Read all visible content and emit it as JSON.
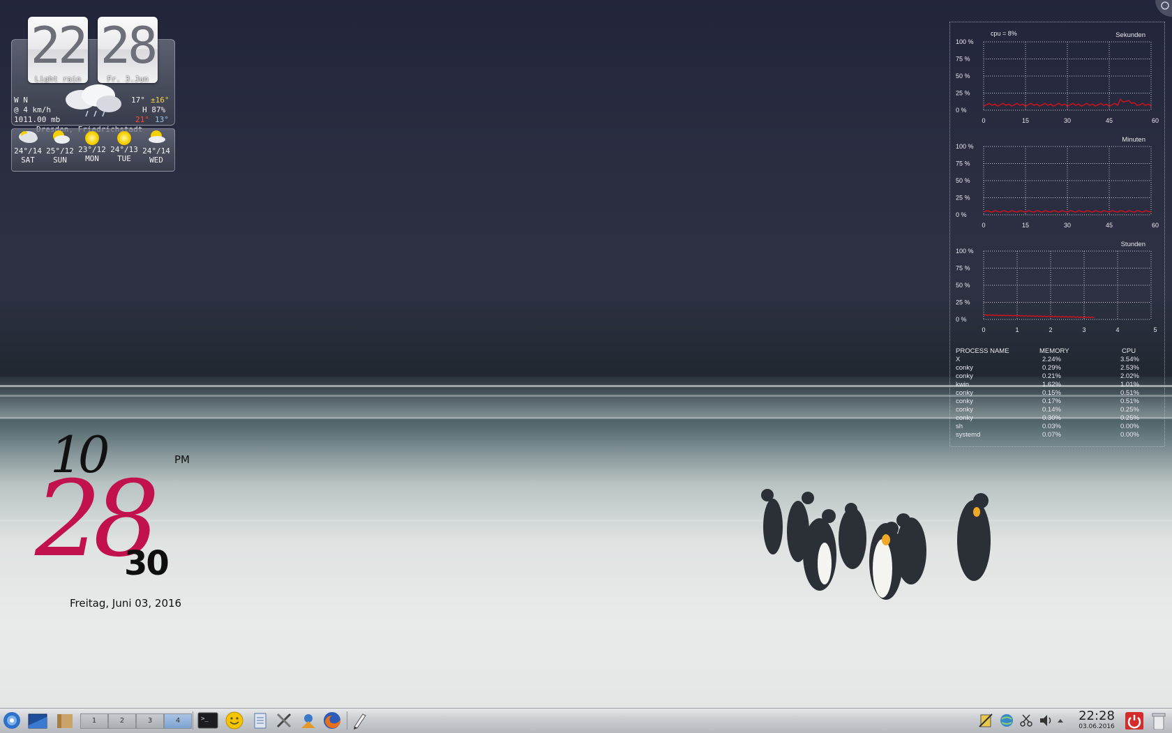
{
  "weather_widget": {
    "hour": "22",
    "minute": "28",
    "condition": "Light rain",
    "date": "Fr. 3.Jun",
    "wind_dir": "W N",
    "wind_speed": "@ 4 km/h",
    "pressure": "1011.00 mb",
    "temp": "17°",
    "feels_like": "±16°",
    "humidity": "H 87%",
    "high": "21°",
    "low": "13°",
    "location": "Dresden, Friedrichstadt",
    "forecast": [
      {
        "temp": "24°/14",
        "day": "SAT",
        "icon": "rain-cloud-icon"
      },
      {
        "temp": "25°/12",
        "day": "SUN",
        "icon": "partly-sunny-icon"
      },
      {
        "temp": "23°/12",
        "day": "MON",
        "icon": "sun-icon"
      },
      {
        "temp": "24°/13",
        "day": "TUE",
        "icon": "sun-icon"
      },
      {
        "temp": "24°/14",
        "day": "WED",
        "icon": "partly-sunny-icon"
      }
    ]
  },
  "monitor": {
    "cpu_label": "cpu = 8%",
    "y_ticks": [
      "100 %",
      "75 %",
      "50 %",
      "25 %",
      "0 %"
    ],
    "graphs": [
      {
        "title": "Sekunden",
        "x_ticks": [
          "0",
          "15",
          "30",
          "45",
          "60"
        ]
      },
      {
        "title": "Minuten",
        "x_ticks": [
          "0",
          "15",
          "30",
          "45",
          "60"
        ]
      },
      {
        "title": "Stunden",
        "x_ticks": [
          "0",
          "1",
          "2",
          "3",
          "4",
          "5"
        ]
      }
    ],
    "process_headers": {
      "name": "PROCESS NAME",
      "memory": "MEMORY",
      "cpu": "CPU"
    },
    "processes": [
      {
        "name": "X",
        "memory": "2.24%",
        "cpu": "3.54%"
      },
      {
        "name": "conky",
        "memory": "0.29%",
        "cpu": "2.53%"
      },
      {
        "name": "conky",
        "memory": "0.21%",
        "cpu": "2.02%"
      },
      {
        "name": "kwin",
        "memory": "1.62%",
        "cpu": "1.01%"
      },
      {
        "name": "conky",
        "memory": "0.15%",
        "cpu": "0.51%"
      },
      {
        "name": "conky",
        "memory": "0.17%",
        "cpu": "0.51%"
      },
      {
        "name": "conky",
        "memory": "0.14%",
        "cpu": "0.25%"
      },
      {
        "name": "conky",
        "memory": "0.30%",
        "cpu": "0.25%"
      },
      {
        "name": "sh",
        "memory": "0.03%",
        "cpu": "0.00%"
      },
      {
        "name": "systemd",
        "memory": "0.07%",
        "cpu": "0.00%"
      }
    ]
  },
  "big_clock": {
    "hour": "10",
    "minute": "28",
    "second": "30",
    "ampm": "PM",
    "date": "Freitag, Juni 03, 2016",
    "minute_color": "#c2124e"
  },
  "taskbar": {
    "desktops": [
      "1",
      "2",
      "3",
      "4"
    ],
    "active_desktop": "4",
    "clock_time": "22:28",
    "clock_date": "03.06.2016",
    "launchers": [
      "terminal-icon",
      "smiley-icon",
      "notes-icon",
      "tools-icon",
      "system-settings-icon",
      "firefox-icon",
      "editor-icon"
    ]
  }
}
